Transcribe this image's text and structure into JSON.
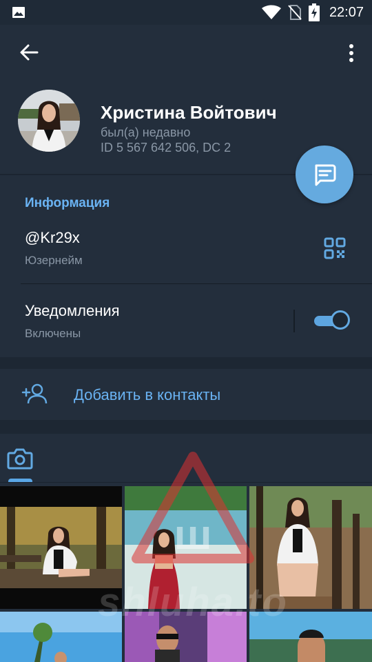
{
  "status_bar": {
    "time": "22:07",
    "icons": [
      "image-notification-icon",
      "wifi-icon",
      "no-sim-icon",
      "battery-charging-icon"
    ]
  },
  "toolbar": {
    "back_icon": "arrow-left-icon",
    "menu_icon": "more-vertical-icon"
  },
  "profile": {
    "name": "Христина Войтович",
    "status": "был(а) недавно",
    "id_line": "ID 5 567 642 506, DC 2"
  },
  "fab": {
    "icon": "message-icon"
  },
  "info": {
    "title": "Информация",
    "username": "@Kr29x",
    "username_label": "Юзернейм",
    "qr_icon": "qr-code-icon",
    "notifications_title": "Уведомления",
    "notifications_value": "Включены",
    "notifications_enabled": true
  },
  "actions": {
    "add_contact_label": "Добавить в контакты",
    "add_contact_icon": "add-user-icon"
  },
  "media": {
    "tab_icon": "camera-icon",
    "photos": [
      "photo-1",
      "photo-2",
      "photo-3",
      "photo-4",
      "photo-5",
      "photo-6"
    ]
  },
  "watermark": {
    "text": "shluha.to",
    "glyph": "Ш"
  },
  "colors": {
    "background": "#1d2733",
    "panel": "#232e3c",
    "accent": "#6ab3f3",
    "fab": "#65aadf",
    "secondary_text": "#8a97a6"
  }
}
